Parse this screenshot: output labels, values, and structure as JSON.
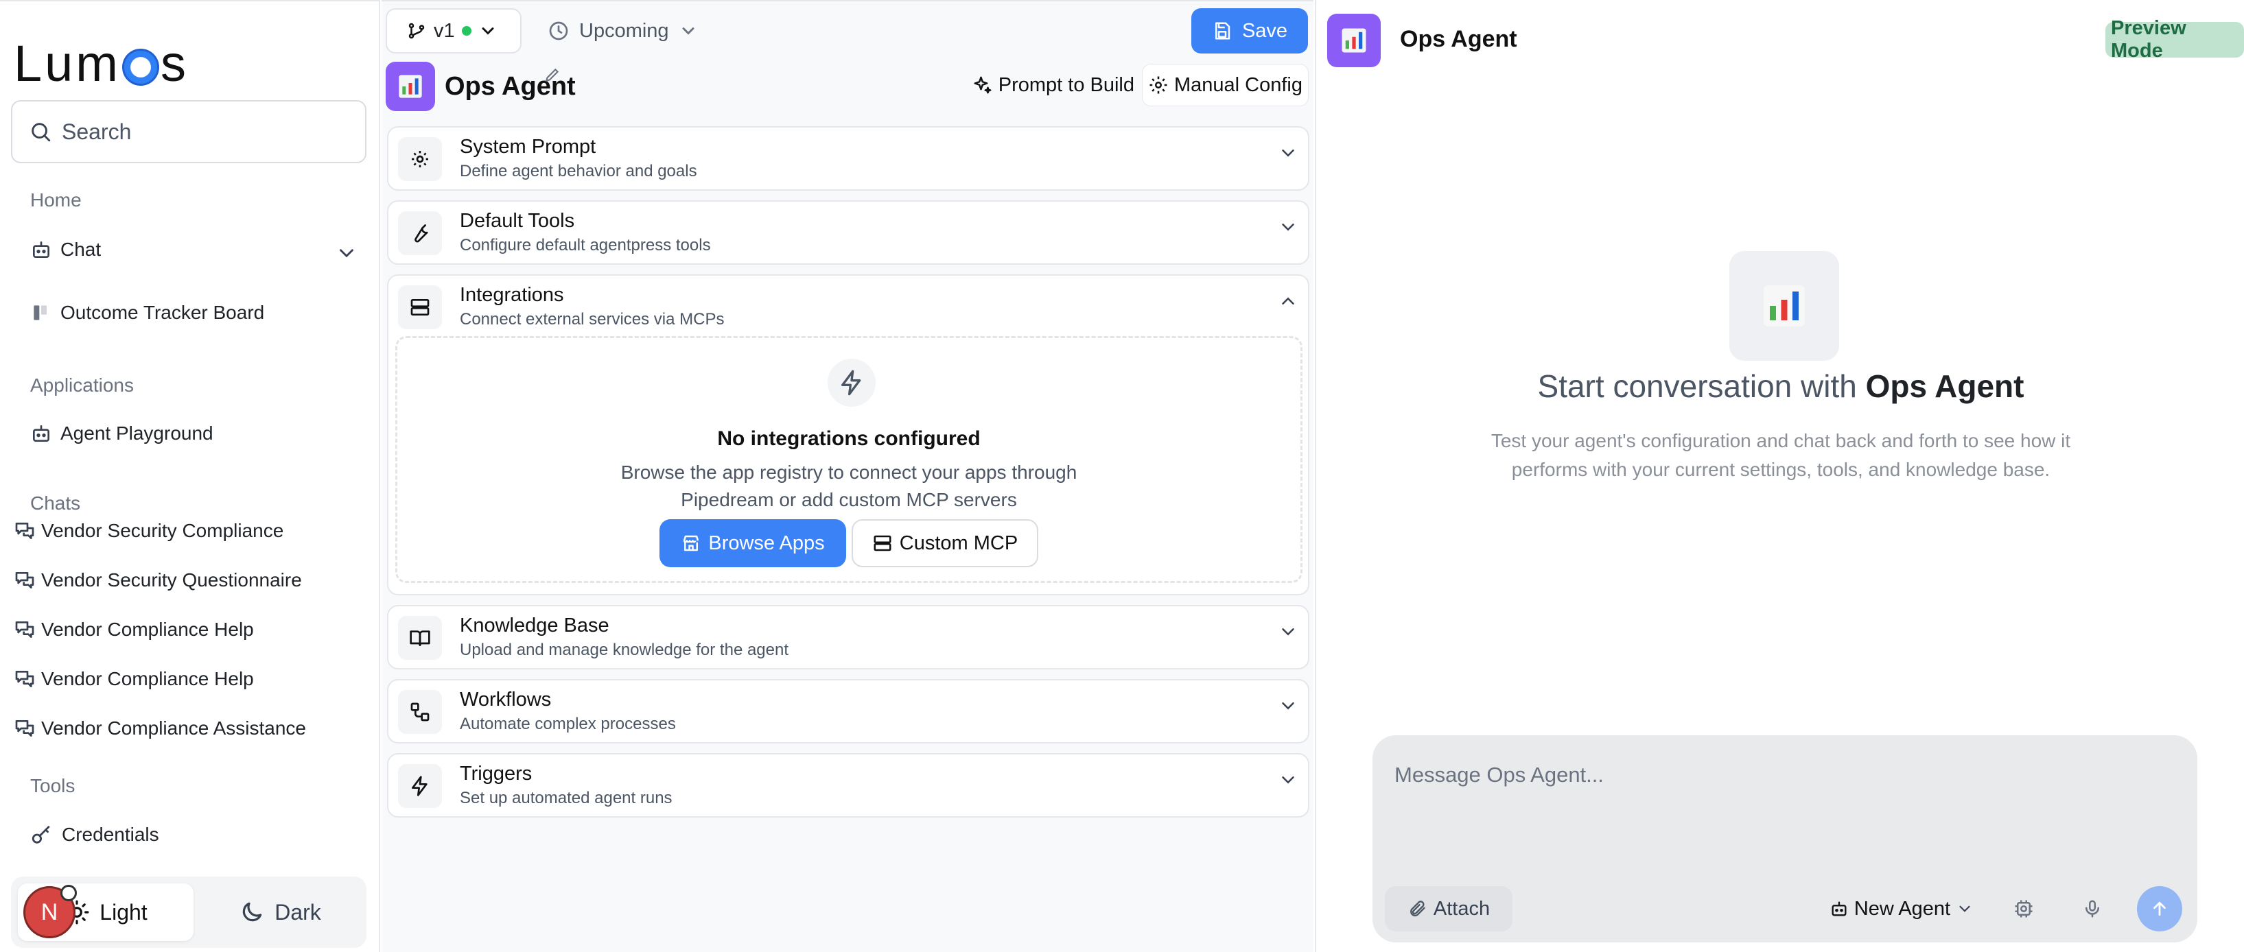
{
  "sidebar": {
    "logo_left": "Lum",
    "logo_right": "s",
    "search_placeholder": "Search",
    "home_label": "Home",
    "chat_label": "Chat",
    "outcome_label": "Outcome Tracker Board",
    "applications_label": "Applications",
    "agent_playground_label": "Agent Playground",
    "chats_label": "Chats",
    "chats": [
      "Vendor Security Compliance",
      "Vendor Security Questionnaire",
      "Vendor Compliance Help",
      "Vendor Compliance Help",
      "Vendor Compliance Assistance"
    ],
    "tools_label": "Tools",
    "credentials_label": "Credentials",
    "theme_light": "Light",
    "theme_dark": "Dark",
    "avatar_initial": "N"
  },
  "config": {
    "version_label": "v1",
    "upcoming_label": "Upcoming",
    "save_label": "Save",
    "agent_name": "Ops Agent",
    "prompt_to_build": "Prompt to Build",
    "manual_config": "Manual Config",
    "sections": [
      {
        "title": "System Prompt",
        "subtitle": "Define agent behavior and goals"
      },
      {
        "title": "Default Tools",
        "subtitle": "Configure default agentpress tools"
      },
      {
        "title": "Integrations",
        "subtitle": "Connect external services via MCPs"
      },
      {
        "title": "Knowledge Base",
        "subtitle": "Upload and manage knowledge for the agent"
      },
      {
        "title": "Workflows",
        "subtitle": "Automate complex processes"
      },
      {
        "title": "Triggers",
        "subtitle": "Set up automated agent runs"
      }
    ],
    "integrations": {
      "empty_title": "No integrations configured",
      "empty_desc_line1": "Browse the app registry to connect your apps through",
      "empty_desc_line2": "Pipedream or add custom MCP servers",
      "browse_apps": "Browse Apps",
      "custom_mcp": "Custom MCP"
    }
  },
  "preview": {
    "agent_name": "Ops Agent",
    "badge": "Preview Mode",
    "heading_prefix": "Start conversation with",
    "heading_agent": "Ops Agent",
    "desc_line1": "Test your agent's configuration and chat back and forth to see how it",
    "desc_line2": "performs with your current settings, tools, and knowledge base.",
    "composer_placeholder": "Message Ops Agent...",
    "attach_label": "Attach",
    "new_agent_label": "New Agent"
  },
  "colors": {
    "accent_blue": "#3b82f6",
    "agent_purple": "#8b5cf6",
    "status_green": "#22c55e",
    "preview_badge_bg": "#bfe3cf"
  }
}
